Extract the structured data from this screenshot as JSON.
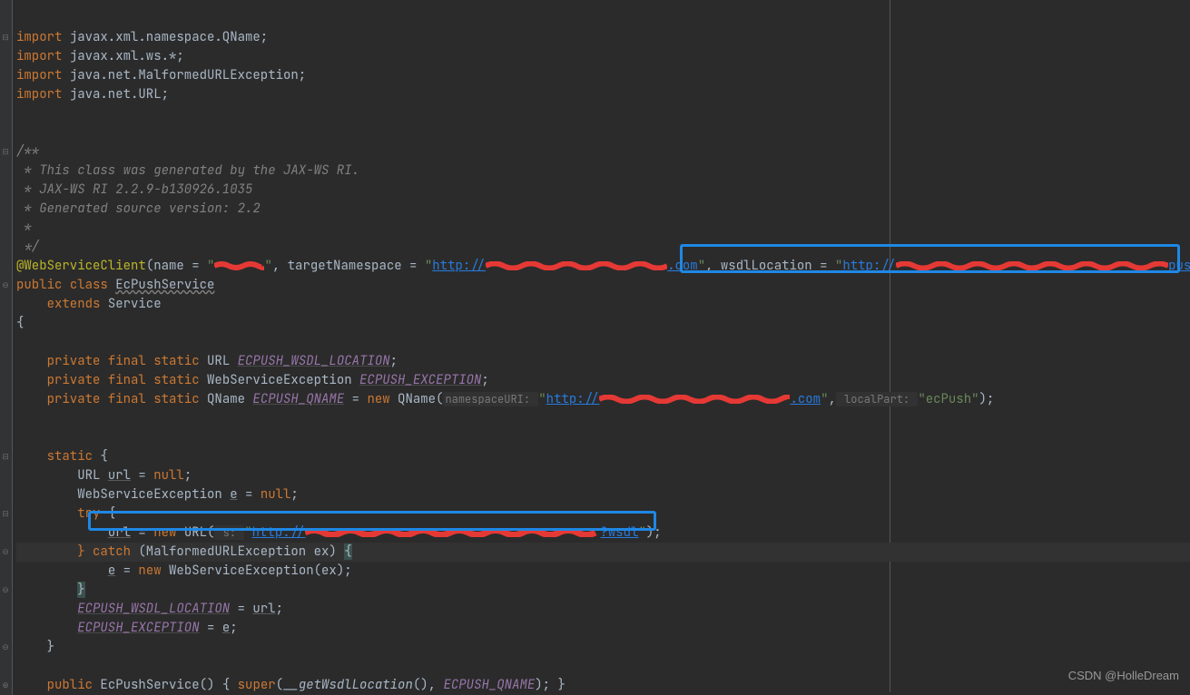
{
  "code": {
    "import1": {
      "kw": "import",
      "pkg": "javax.xml.namespace.QName;"
    },
    "import2": {
      "kw": "import",
      "pkg": "javax.xml.ws.*;"
    },
    "import3": {
      "kw": "import",
      "pkg": "java.net.MalformedURLException;"
    },
    "import4": {
      "kw": "import",
      "pkg": "java.net.URL;"
    },
    "javadoc": {
      "l1": "/**",
      "l2": " * This class was generated by the JAX-WS RI.",
      "l3": " * JAX-WS RI 2.2.9-b130926.1035",
      "l4": " * Generated source version: 2.2",
      "l5": " *",
      "l6": " */"
    },
    "annotation_name": "@WebServiceClient",
    "annotation_params": {
      "name_label": "name = ",
      "quote": "\"",
      "comma": ", ",
      "targetNs_label": "targetNamespace = ",
      "http_prefix": "http://",
      "dotcom": ".com",
      "wsdlLoc_label": " wsdlLocation = ",
      "wsdl_suffix": "push?ws"
    },
    "class_decl": {
      "public": "public ",
      "class_kw": "class ",
      "name": "EcPushService",
      "extends_kw": "extends ",
      "parent": "Service"
    },
    "brace_open": "{",
    "brace_close": "}",
    "fields": {
      "f1": {
        "mods": "private final static ",
        "type": "URL ",
        "name": "ECPUSH_WSDL_LOCATION",
        "semi": ";"
      },
      "f2": {
        "mods": "private final static ",
        "type": "WebServiceException ",
        "name": "ECPUSH_EXCEPTION",
        "semi": ";"
      },
      "f3": {
        "mods": "private final static ",
        "type": "QName ",
        "name": "ECPUSH_QNAME",
        "eq": " = ",
        "new_kw": "new ",
        "ctor": "QName(",
        "hint1": "namespaceURI: ",
        "http": "http://",
        "dotcom": ".com",
        "hint2": " localPart: ",
        "val2": "\"ecPush\"",
        "close": ");"
      }
    },
    "static_block": {
      "kw": "static ",
      "brace": "{",
      "l1": {
        "type": "URL ",
        "var": "url",
        "rest": " = ",
        "null_kw": "null",
        "semi": ";"
      },
      "l2": {
        "type": "WebServiceException ",
        "var": "e",
        "rest": " = ",
        "null_kw": "null",
        "semi": ";"
      },
      "try_kw": "try ",
      "try_brace": "{",
      "l3": {
        "var": "url",
        "eq": " = ",
        "new_kw": "new ",
        "ctor": "URL(",
        "hint": " s: ",
        "http": "http://",
        "suffix": "?wsdl",
        "close": ");"
      },
      "catch_kw": "} catch ",
      "catch_params": "(MalformedURLException ex) ",
      "catch_brace": "{",
      "l4": {
        "var": "e",
        "eq": " = ",
        "new_kw": "new ",
        "ctor": "WebServiceException(ex)",
        "semi": ";"
      },
      "l5": {
        "name": "ECPUSH_WSDL_LOCATION",
        "eq": " = ",
        "var": "url",
        "semi": ";"
      },
      "l6": {
        "name": "ECPUSH_EXCEPTION",
        "eq": " = ",
        "var": "e",
        "semi": ";"
      }
    },
    "ctor": {
      "public": "public ",
      "name": "EcPushService",
      "params": "() ",
      "brace": "{ ",
      "super_kw": "super",
      "args_open": "(",
      "method": "__getWsdlLocation",
      "args_mid": "(), ",
      "qname": "ECPUSH_QNAME",
      "args_close": "); ",
      "brace_close": "}"
    }
  },
  "watermark": "CSDN @HolleDream"
}
